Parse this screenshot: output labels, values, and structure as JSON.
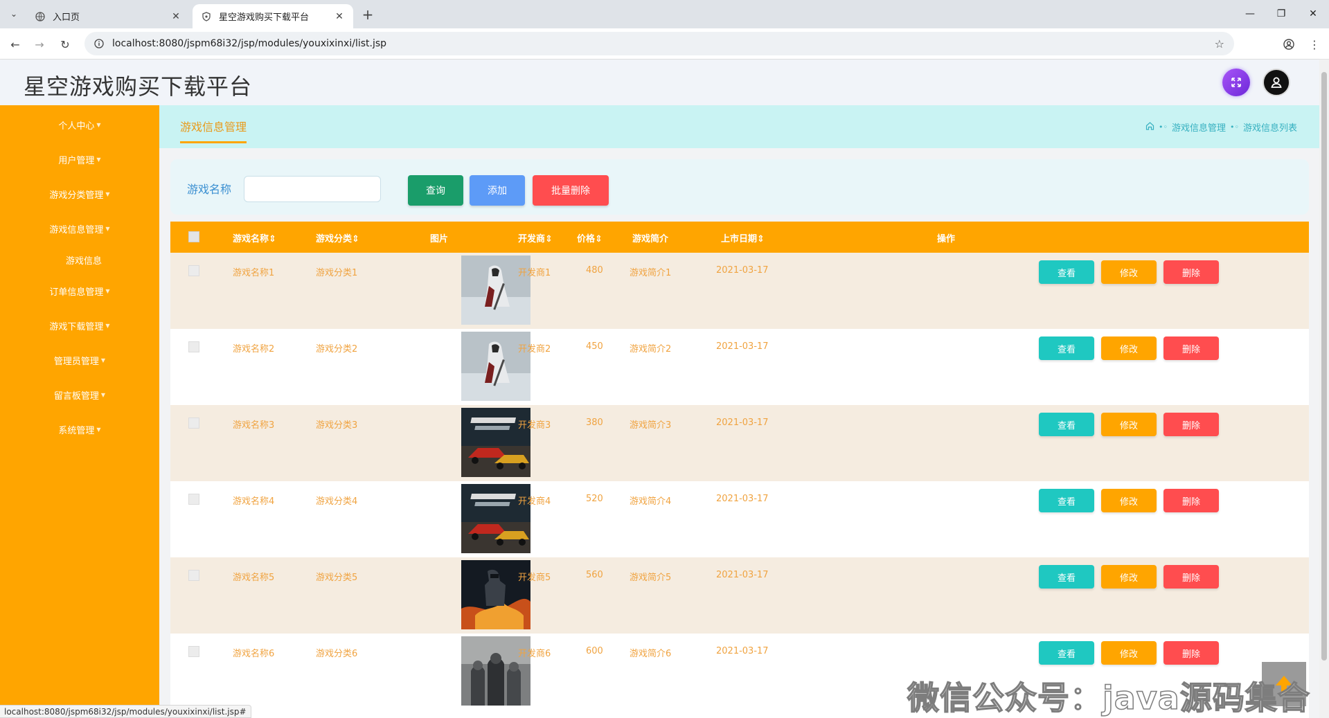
{
  "browser": {
    "tabs": [
      {
        "title": "入口页",
        "active": false
      },
      {
        "title": "星空游戏购买下载平台",
        "active": true
      }
    ],
    "url": "localhost:8080/jspm68i32/jsp/modules/youxixinxi/list.jsp",
    "status_url": "localhost:8080/jspm68i32/jsp/modules/youxixinxi/list.jsp#"
  },
  "header": {
    "title": "星空游戏购买下载平台"
  },
  "sidebar": {
    "items": [
      {
        "label": "个人中心",
        "has_caret": true
      },
      {
        "label": "用户管理",
        "has_caret": true
      },
      {
        "label": "游戏分类管理",
        "has_caret": true
      },
      {
        "label": "游戏信息管理",
        "has_caret": true
      },
      {
        "label": "游戏信息",
        "has_caret": false
      },
      {
        "label": "订单信息管理",
        "has_caret": true
      },
      {
        "label": "游戏下载管理",
        "has_caret": true
      },
      {
        "label": "管理员管理",
        "has_caret": true
      },
      {
        "label": "留言板管理",
        "has_caret": true
      },
      {
        "label": "系统管理",
        "has_caret": true
      }
    ]
  },
  "breadcrumb": {
    "tab": "游戏信息管理",
    "trail": [
      "游戏信息管理",
      "游戏信息列表"
    ]
  },
  "search": {
    "label": "游戏名称",
    "value": "",
    "query_button": "查询",
    "add_button": "添加",
    "batch_delete_button": "批量删除"
  },
  "table": {
    "headers": {
      "name": "游戏名称",
      "category": "游戏分类",
      "image": "图片",
      "developer": "开发商",
      "price": "价格",
      "intro": "游戏简介",
      "release_date": "上市日期",
      "actions": "操作"
    },
    "sort_glyph": "⇕",
    "action_labels": {
      "view": "查看",
      "edit": "修改",
      "delete": "删除"
    },
    "rows": [
      {
        "name": "游戏名称1",
        "category": "游戏分类1",
        "image": "assassin-creed",
        "developer": "开发商1",
        "price": "480",
        "intro": "游戏简介1",
        "date": "2021-03-17"
      },
      {
        "name": "游戏名称2",
        "category": "游戏分类2",
        "image": "assassin-creed",
        "developer": "开发商2",
        "price": "450",
        "intro": "游戏简介2",
        "date": "2021-03-17"
      },
      {
        "name": "游戏名称3",
        "category": "游戏分类3",
        "image": "need-for-speed",
        "developer": "开发商3",
        "price": "380",
        "intro": "游戏简介3",
        "date": "2021-03-17"
      },
      {
        "name": "游戏名称4",
        "category": "游戏分类4",
        "image": "need-for-speed",
        "developer": "开发商4",
        "price": "520",
        "intro": "游戏简介4",
        "date": "2021-03-17"
      },
      {
        "name": "游戏名称5",
        "category": "游戏分类5",
        "image": "soldier-fire",
        "developer": "开发商5",
        "price": "560",
        "intro": "游戏简介5",
        "date": "2021-03-17"
      },
      {
        "name": "游戏名称6",
        "category": "游戏分类6",
        "image": "soldiers-squad",
        "developer": "开发商6",
        "price": "600",
        "intro": "游戏简介6",
        "date": "2021-03-17"
      }
    ]
  },
  "watermark": "微信公众号：java源码集合",
  "colors": {
    "sidebar": "#ffa500",
    "table_header": "#ffa500",
    "breadcrumb_bg": "#c9f3f3",
    "view_button": "#1fc8c1",
    "edit_button": "#ffa500",
    "delete_button": "#ff4d4f",
    "query_button": "#1a9d6a",
    "add_button": "#5d9bf7"
  }
}
